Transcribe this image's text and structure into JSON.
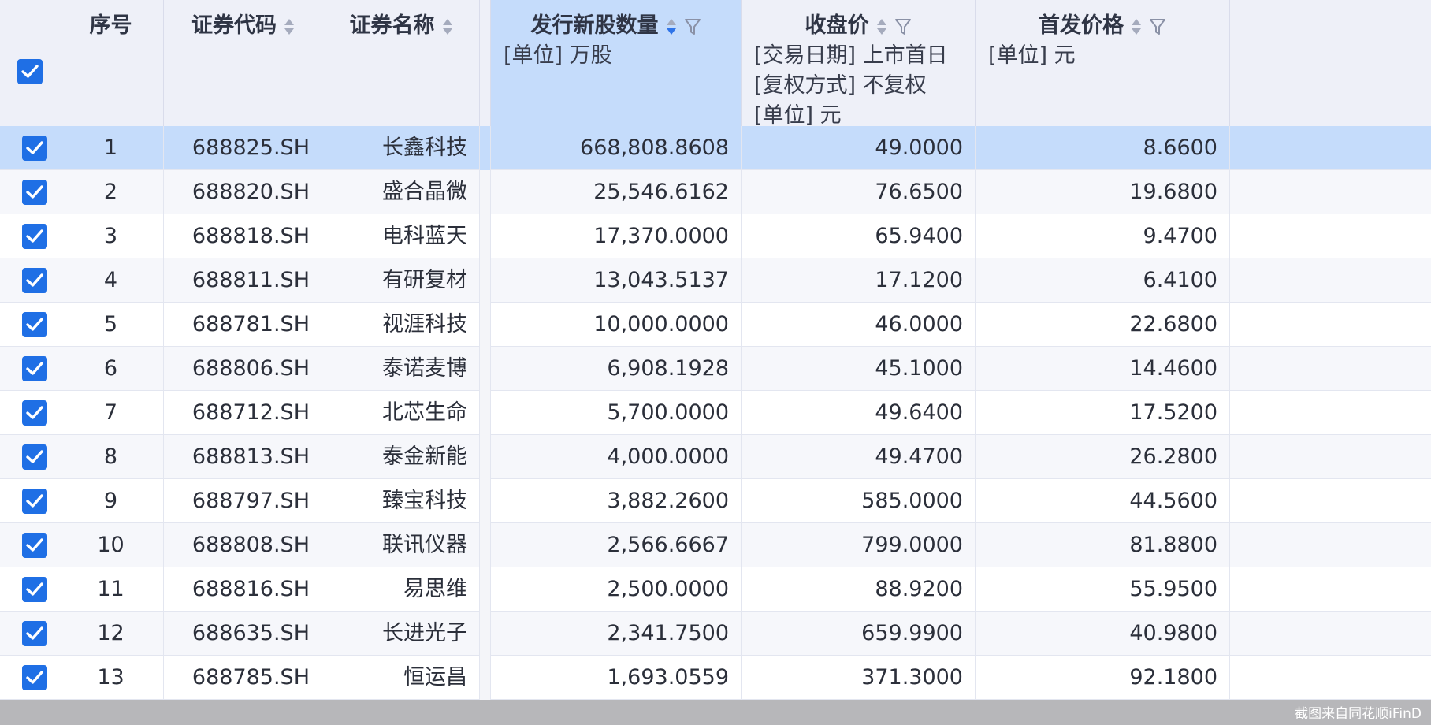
{
  "table": {
    "columns": [
      {
        "key": "index",
        "title": "序号",
        "sortable": false,
        "filterable": false,
        "sub": []
      },
      {
        "key": "code",
        "title": "证券代码",
        "sortable": true,
        "filterable": false,
        "sub": []
      },
      {
        "key": "name",
        "title": "证券名称",
        "sortable": true,
        "filterable": false,
        "sub": []
      },
      {
        "key": "shares",
        "title": "发行新股数量",
        "sortable": true,
        "sort_state": "descending",
        "filterable": true,
        "active": true,
        "sub": [
          "[单位] 万股"
        ]
      },
      {
        "key": "close",
        "title": "收盘价",
        "sortable": true,
        "filterable": true,
        "sub": [
          "[交易日期] 上市首日",
          "[复权方式] 不复权",
          "[单位] 元"
        ]
      },
      {
        "key": "ipo_price",
        "title": "首发价格",
        "sortable": true,
        "filterable": true,
        "sub": [
          "[单位] 元"
        ]
      }
    ],
    "header_checkbox_checked": true,
    "rows": [
      {
        "index": "1",
        "code": "688825.SH",
        "name": "长鑫科技",
        "shares": "668,808.8608",
        "close": "49.0000",
        "ipo_price": "8.6600",
        "checked": true,
        "selected": true
      },
      {
        "index": "2",
        "code": "688820.SH",
        "name": "盛合晶微",
        "shares": "25,546.6162",
        "close": "76.6500",
        "ipo_price": "19.6800",
        "checked": true
      },
      {
        "index": "3",
        "code": "688818.SH",
        "name": "电科蓝天",
        "shares": "17,370.0000",
        "close": "65.9400",
        "ipo_price": "9.4700",
        "checked": true
      },
      {
        "index": "4",
        "code": "688811.SH",
        "name": "有研复材",
        "shares": "13,043.5137",
        "close": "17.1200",
        "ipo_price": "6.4100",
        "checked": true
      },
      {
        "index": "5",
        "code": "688781.SH",
        "name": "视涯科技",
        "shares": "10,000.0000",
        "close": "46.0000",
        "ipo_price": "22.6800",
        "checked": true
      },
      {
        "index": "6",
        "code": "688806.SH",
        "name": "泰诺麦博",
        "shares": "6,908.1928",
        "close": "45.1000",
        "ipo_price": "14.4600",
        "checked": true
      },
      {
        "index": "7",
        "code": "688712.SH",
        "name": "北芯生命",
        "shares": "5,700.0000",
        "close": "49.6400",
        "ipo_price": "17.5200",
        "checked": true
      },
      {
        "index": "8",
        "code": "688813.SH",
        "name": "泰金新能",
        "shares": "4,000.0000",
        "close": "49.4700",
        "ipo_price": "26.2800",
        "checked": true
      },
      {
        "index": "9",
        "code": "688797.SH",
        "name": "臻宝科技",
        "shares": "3,882.2600",
        "close": "585.0000",
        "ipo_price": "44.5600",
        "checked": true
      },
      {
        "index": "10",
        "code": "688808.SH",
        "name": "联讯仪器",
        "shares": "2,566.6667",
        "close": "799.0000",
        "ipo_price": "81.8800",
        "checked": true
      },
      {
        "index": "11",
        "code": "688816.SH",
        "name": "易思维",
        "shares": "2,500.0000",
        "close": "88.9200",
        "ipo_price": "55.9500",
        "checked": true
      },
      {
        "index": "12",
        "code": "688635.SH",
        "name": "长进光子",
        "shares": "2,341.7500",
        "close": "659.9900",
        "ipo_price": "40.9800",
        "checked": true
      },
      {
        "index": "13",
        "code": "688785.SH",
        "name": "恒运昌",
        "shares": "1,693.0559",
        "close": "371.3000",
        "ipo_price": "92.1800",
        "checked": true
      }
    ]
  },
  "watermark": {
    "text": "截图来自同花顺iFinD"
  },
  "colors": {
    "accent": "#1f6fe5",
    "selected_row": "#c5dcfb",
    "header_bg": "#eef0f8"
  },
  "icons": {
    "sort": "sort-arrows-icon",
    "filter": "filter-funnel-icon",
    "check": "checkmark-icon"
  }
}
